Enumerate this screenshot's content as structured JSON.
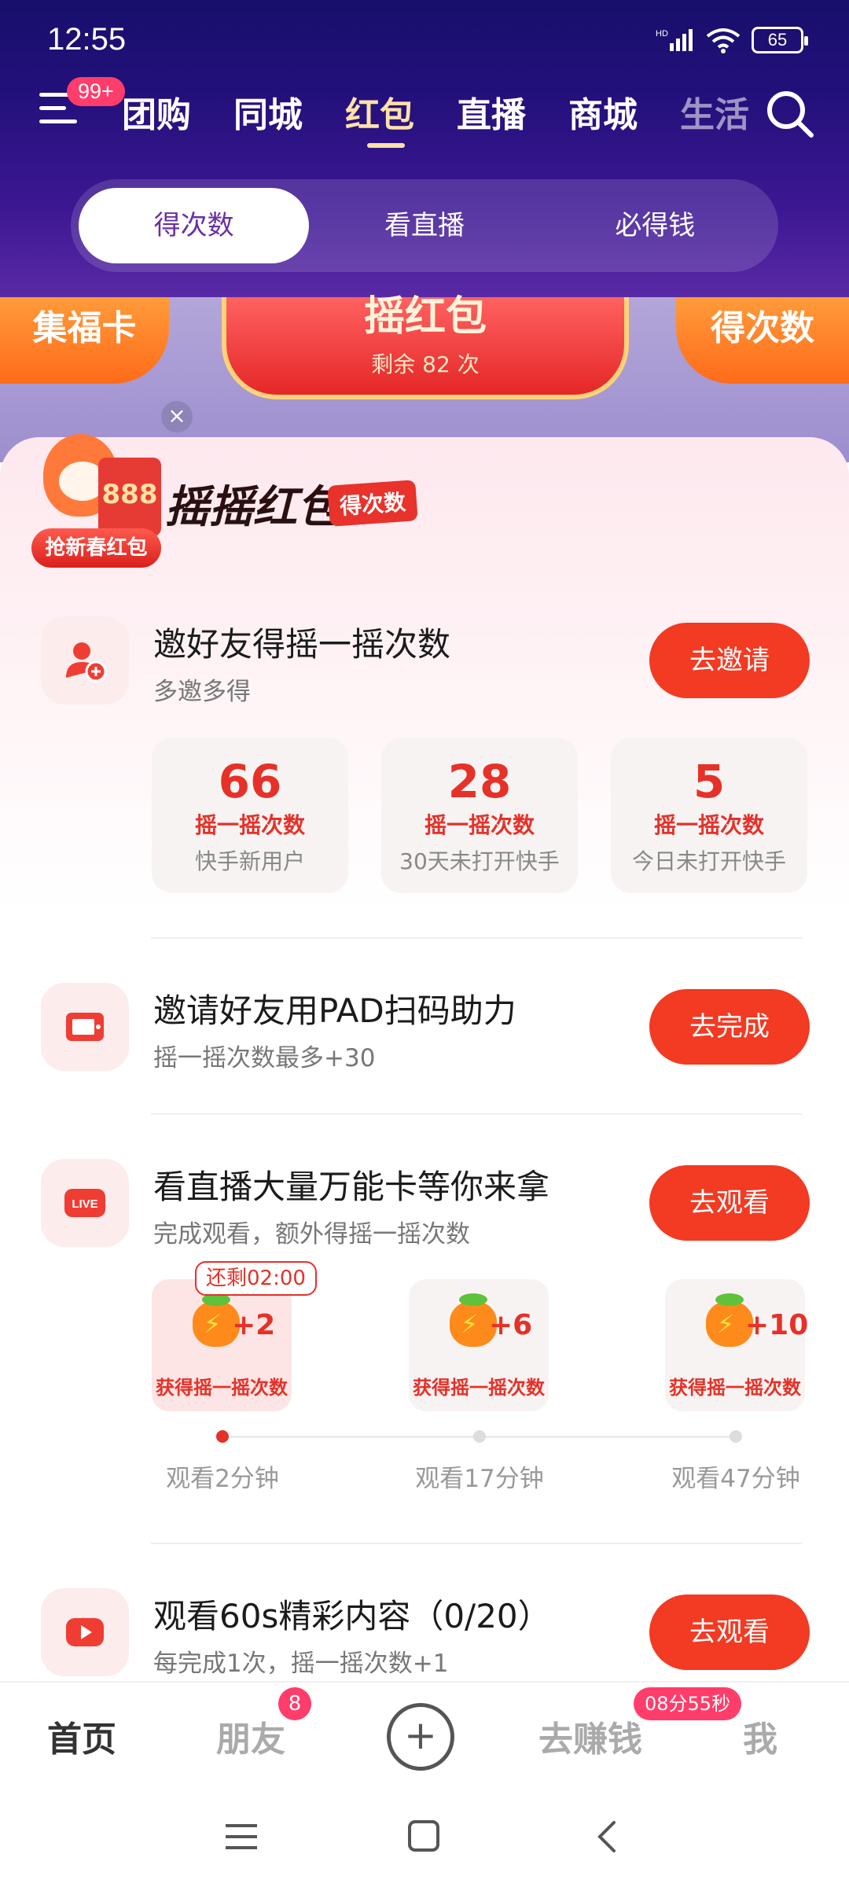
{
  "status": {
    "time": "12:55",
    "battery": "65"
  },
  "nav": {
    "badge": "99+",
    "tabs": [
      "团购",
      "同城",
      "红包",
      "直播",
      "商城",
      "生活"
    ]
  },
  "segment": [
    "得次数",
    "看直播",
    "必得钱"
  ],
  "banner": {
    "left": "集福卡",
    "center_title": "摇红包",
    "center_sub": "剩余 82 次",
    "right": "得次数"
  },
  "mascot": {
    "num": "888",
    "caption": "抢新春红包"
  },
  "panel": {
    "title": "摇摇红包",
    "tag": "得次数"
  },
  "tasks": [
    {
      "title": "邀好友得摇一摇次数",
      "sub": "多邀多得",
      "button": "去邀请"
    },
    {
      "title": "邀请好友用PAD扫码助力",
      "sub": "摇一摇次数最多+30",
      "button": "去完成"
    },
    {
      "title": "看直播大量万能卡等你来拿",
      "sub": "完成观看，额外得摇一摇次数",
      "button": "去观看"
    },
    {
      "title": "观看60s精彩内容（0/20）",
      "sub": "每完成1次，摇一摇次数+1",
      "button": "去观看"
    }
  ],
  "stats": [
    {
      "num": "66",
      "label": "摇一摇次数",
      "desc": "快手新用户"
    },
    {
      "num": "28",
      "label": "摇一摇次数",
      "desc": "30天未打开快手"
    },
    {
      "num": "5",
      "label": "摇一摇次数",
      "desc": "今日未打开快手"
    }
  ],
  "rewards": {
    "timer": "还剩02:00",
    "items": [
      {
        "plus": "+2",
        "label": "获得摇一摇次数",
        "time": "观看2分钟"
      },
      {
        "plus": "+6",
        "label": "获得摇一摇次数",
        "time": "观看17分钟"
      },
      {
        "plus": "+10",
        "label": "获得摇一摇次数",
        "time": "观看47分钟"
      }
    ]
  },
  "icons": {
    "live": "LIVE"
  },
  "bottom": {
    "items": [
      "首页",
      "朋友",
      "去赚钱",
      "我"
    ],
    "friend_badge": "8",
    "timer": "08分55秒"
  }
}
